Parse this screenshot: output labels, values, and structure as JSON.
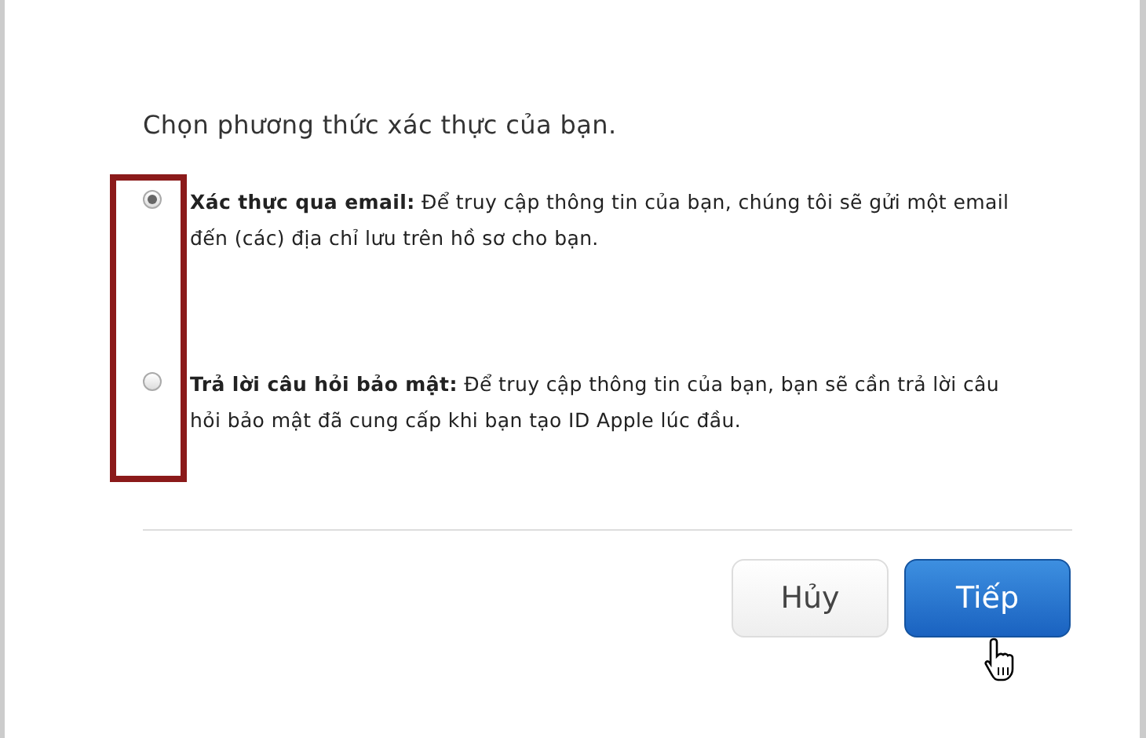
{
  "heading": "Chọn phương thức xác thực của bạn.",
  "options": [
    {
      "text": "**Xác thực qua email:** Để truy cập thông tin của bạn, chúng tôi sẽ gửi một email đến (các) địa chỉ lưu trên hồ sơ cho bạn.",
      "selected": true
    },
    {
      "text": "**Trả lời câu hỏi bảo mật:** Để truy cập thông tin của bạn, bạn sẽ cần trả lời câu hỏi bảo mật đã cung cấp khi bạn tạo ID Apple lúc đầu.",
      "selected": false
    }
  ],
  "buttons": [
    {
      "label": "Hủy",
      "kind": "secondary"
    },
    {
      "label": "Tiếp",
      "kind": "primary"
    }
  ]
}
